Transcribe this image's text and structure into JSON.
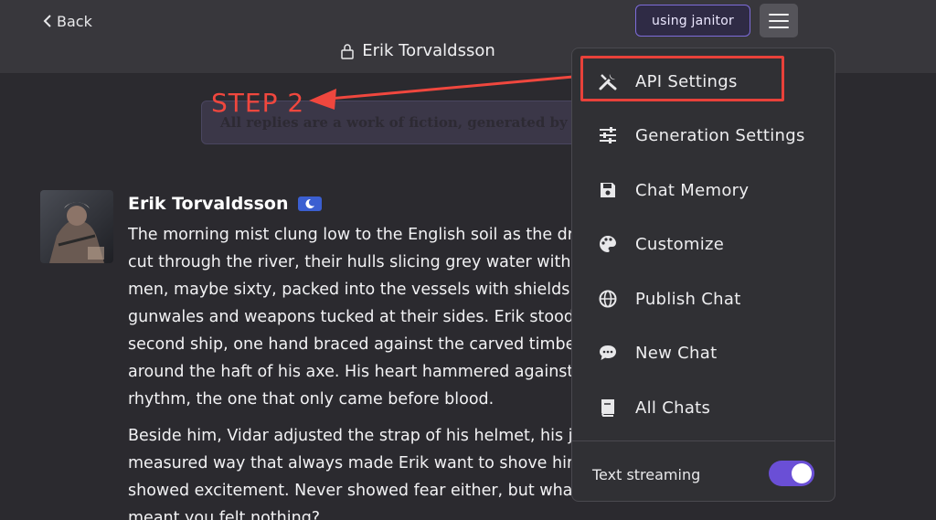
{
  "header": {
    "back_label": "Back",
    "title": "Erik Torvaldsson",
    "using_badge": "using janitor"
  },
  "annotation": {
    "step_label": "STEP 2",
    "color": "#f0473e"
  },
  "disclaimer": "All replies are a work of fiction, generated by",
  "message": {
    "author": "Erik Torvaldsson",
    "paragraphs": [
      [
        "The morning mist clung low to the English soil as the dr",
        "cut through the river, their hulls slicing grey water with",
        "men, maybe sixty, packed into the vessels with shields s",
        "gunwales and weapons tucked at their sides. Erik stood",
        "second ship, one hand braced against the carved timbe",
        "around the haft of his axe. His heart hammered against",
        "rhythm, the one that only came before blood."
      ],
      [
        "Beside him, Vidar adjusted the strap of his helmet, his ja",
        "measured way that always made Erik want to shove him",
        "showed excitement. Never showed fear either, but what",
        "meant you felt nothing?"
      ]
    ]
  },
  "menu": {
    "items": [
      {
        "label": "API Settings",
        "icon": "tools-icon"
      },
      {
        "label": "Generation Settings",
        "icon": "sliders-icon"
      },
      {
        "label": "Chat Memory",
        "icon": "floppy-disk-icon"
      },
      {
        "label": "Customize",
        "icon": "palette-icon"
      },
      {
        "label": "Publish Chat",
        "icon": "globe-icon"
      },
      {
        "label": "New Chat",
        "icon": "chat-bubble-icon"
      },
      {
        "label": "All Chats",
        "icon": "book-icon"
      }
    ],
    "text_streaming_label": "Text streaming",
    "text_streaming_on": true
  },
  "colors": {
    "accent": "#6a4fd6",
    "badge_border": "#7d6cd9",
    "highlight": "#e8413a"
  }
}
